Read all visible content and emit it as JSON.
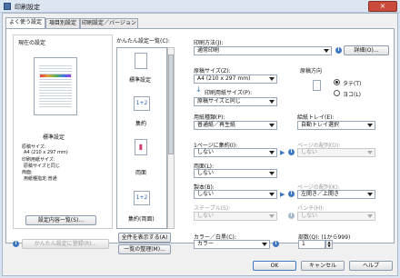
{
  "window": {
    "title": "印刷設定",
    "close": "×"
  },
  "tabs": [
    {
      "label": "よく使う設定"
    },
    {
      "label": "項目別設定"
    },
    {
      "label": "印刷設定／バージョン"
    }
  ],
  "left": {
    "current_label": "現在の設定",
    "preset_name": "標準設定",
    "summary": [
      "原稿サイズ:",
      "A4 (210 x 297 mm)",
      "印刷用紙サイズ:",
      "原稿サイズと同じ",
      "両面:",
      "用紙種指定:普通"
    ],
    "list_button": "設定内容一覧(S)...",
    "register_button": "かんたん設定に登録(R)..."
  },
  "easy": {
    "label": "かんたん設定一覧(C):",
    "items": [
      {
        "label": "標準設定",
        "icon": "1"
      },
      {
        "label": "集約",
        "icon": "1+2"
      },
      {
        "label": "両面",
        "icon": "▮"
      },
      {
        "label": "集約(両面)",
        "icon": "1+2"
      }
    ],
    "show_all": "全件を表示する(A)",
    "manage": "一覧の整理(M)..."
  },
  "right": {
    "method_label": "印刷方法(J):",
    "method_value": "通常印刷",
    "detail_button": "詳細(O)...",
    "orig_size_label": "原稿サイズ(Z):",
    "orig_size_value": "A4 (210 x 297 mm)",
    "paper_size_label": "印刷用紙サイズ(P):",
    "paper_size_value": "原稿サイズと同じ",
    "orientation_label": "原稿方向",
    "portrait": "タテ(T)",
    "landscape": "ヨコ(L)",
    "paper_type_label": "用紙種類(P):",
    "paper_type_value": "普通紙／再生紙",
    "tray_label": "給紙トレイ(E):",
    "tray_value": "自動トレイ選択",
    "nup_label": "1ページに集約(I):",
    "nup_value": "しない",
    "page_order_label": "ページの配列(O):",
    "page_order_value": "しない",
    "duplex_label": "両面(L):",
    "duplex_value": "しない",
    "collate_label": "製本(B):",
    "collate_value": "しない",
    "open_dir_label": "ページの配列(K):",
    "open_dir_value": "左開き／上開き",
    "staple_label": "ステープル(S):",
    "staple_value": "しない",
    "punch_label": "パンチ(H):",
    "punch_value": "しない",
    "color_label": "カラー／白黒(C):",
    "color_value": "カラー",
    "copies_label": "部数(Q): (1から999)",
    "copies_value": "1"
  },
  "footer": {
    "ok": "OK",
    "cancel": "キャンセル",
    "help": "ヘルプ"
  },
  "colors": {
    "accent": "#3f78c0",
    "titlebar": "#dce6f2",
    "close": "#c94b3b"
  }
}
